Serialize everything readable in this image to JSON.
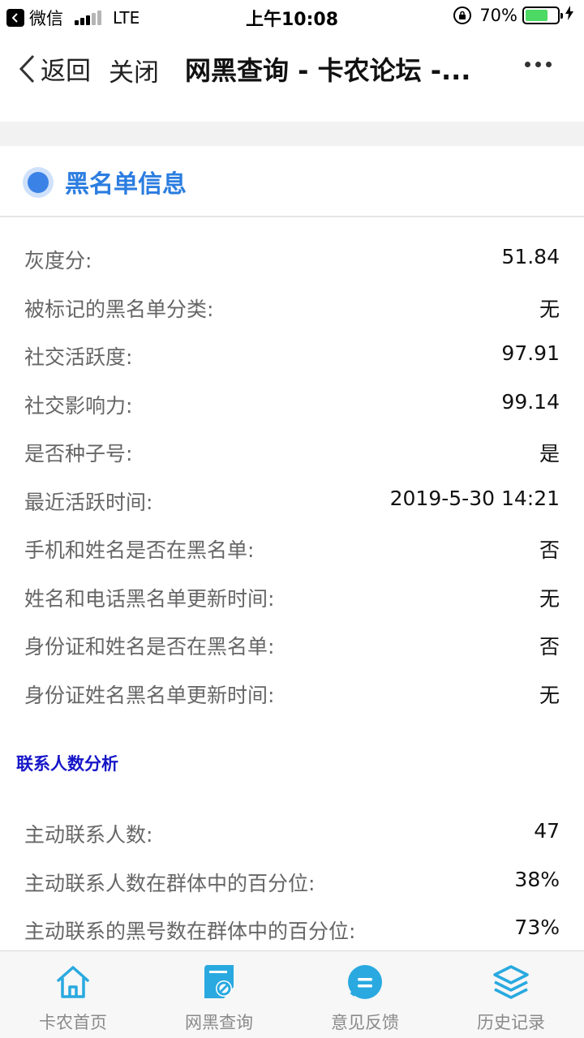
{
  "status_bar": {
    "app": "微信",
    "network": "LTE",
    "time": "上午10:08",
    "battery": "70%",
    "battery_level": 0.7
  },
  "nav": {
    "back": "返回",
    "close": "关闭",
    "title": "网黑查询 - 卡农论坛 -..."
  },
  "section": {
    "title": "黑名单信息"
  },
  "blacklist_rows": [
    {
      "label": "灰度分:",
      "value": "51.84"
    },
    {
      "label": "被标记的黑名单分类:",
      "value": "无"
    },
    {
      "label": "社交活跃度:",
      "value": "97.91"
    },
    {
      "label": "社交影响力:",
      "value": "99.14"
    },
    {
      "label": "是否种子号:",
      "value": "是"
    },
    {
      "label": "最近活跃时间:",
      "value": "2019-5-30 14:21"
    },
    {
      "label": "手机和姓名是否在黑名单:",
      "value": "否"
    },
    {
      "label": "姓名和电话黑名单更新时间:",
      "value": "无"
    },
    {
      "label": "身份证和姓名是否在黑名单:",
      "value": "否"
    },
    {
      "label": "身份证姓名黑名单更新时间:",
      "value": "无"
    }
  ],
  "contacts": {
    "title": "联系人数分析",
    "rows": [
      {
        "label": "主动联系人数:",
        "value": "47"
      },
      {
        "label": "主动联系人数在群体中的百分位:",
        "value": "38%"
      },
      {
        "label": "主动联系的黑号数在群体中的百分位:",
        "value": "73%"
      }
    ]
  },
  "tabs": [
    {
      "label": "卡农首页",
      "icon": "home-icon"
    },
    {
      "label": "网黑查询",
      "icon": "blacklist-query-icon"
    },
    {
      "label": "意见反馈",
      "icon": "feedback-icon"
    },
    {
      "label": "历史记录",
      "icon": "history-layers-icon"
    }
  ],
  "colors": {
    "accent": "#2b7de0",
    "tab_icon": "#29a9e0",
    "subtitle": "#1515c8"
  }
}
